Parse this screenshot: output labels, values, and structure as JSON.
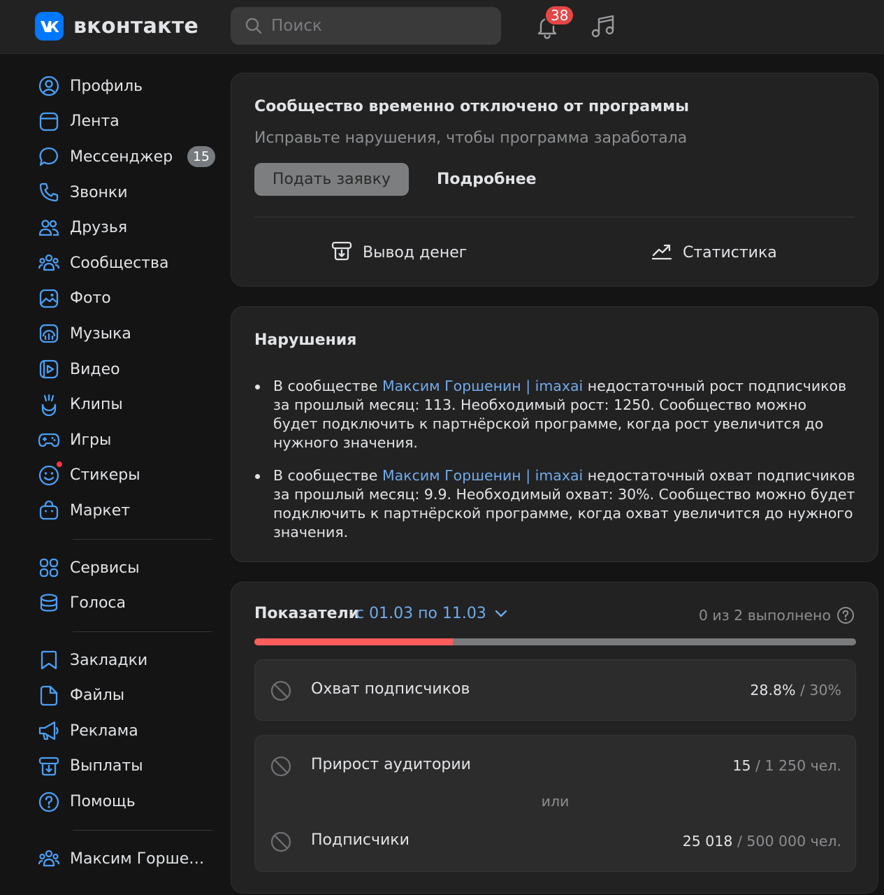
{
  "header": {
    "logo_text": "вконтакте",
    "search_placeholder": "Поиск",
    "notifications_count": "38",
    "brand_color": "#0077ff"
  },
  "sidebar": {
    "items": [
      {
        "label": "Профиль",
        "icon": "user-circle-icon"
      },
      {
        "label": "Лента",
        "icon": "newsfeed-icon"
      },
      {
        "label": "Мессенджер",
        "icon": "message-icon",
        "count": "15"
      },
      {
        "label": "Звонки",
        "icon": "phone-icon"
      },
      {
        "label": "Друзья",
        "icon": "friends-icon"
      },
      {
        "label": "Сообщества",
        "icon": "communities-icon"
      },
      {
        "label": "Фото",
        "icon": "photo-icon"
      },
      {
        "label": "Музыка",
        "icon": "music-icon"
      },
      {
        "label": "Видео",
        "icon": "video-icon"
      },
      {
        "label": "Клипы",
        "icon": "clips-icon"
      },
      {
        "label": "Игры",
        "icon": "gamepad-icon"
      },
      {
        "label": "Стикеры",
        "icon": "smile-icon"
      },
      {
        "label": "Маркет",
        "icon": "market-bag-icon"
      }
    ],
    "group2": [
      {
        "label": "Сервисы",
        "icon": "services-grid-icon"
      },
      {
        "label": "Голоса",
        "icon": "coins-icon"
      }
    ],
    "group3": [
      {
        "label": "Закладки",
        "icon": "bookmark-icon"
      },
      {
        "label": "Файлы",
        "icon": "file-icon"
      },
      {
        "label": "Реклама",
        "icon": "megaphone-icon"
      },
      {
        "label": "Выплаты",
        "icon": "payout-icon"
      },
      {
        "label": "Помощь",
        "icon": "help-icon"
      }
    ],
    "group4": [
      {
        "label": "Максим Горшени...",
        "icon": "community-group-icon"
      }
    ]
  },
  "program_card": {
    "title": "Сообщество временно отключено от программы",
    "subtitle": "Исправьте нарушения, чтобы программа заработала",
    "apply_button": "Подать заявку",
    "more_button": "Подробнее",
    "withdraw_label": "Вывод денег",
    "stats_label": "Статистика"
  },
  "violations_card": {
    "title": "Нарушения",
    "items": [
      {
        "prefix": "В сообществе ",
        "link": "Максим Горшенин | imaxai",
        "text": " недостаточный рост подписчиков за прошлый месяц: 113. Необходимый рост: 1250. Сообщество можно будет подключить к партнёрской программе, когда рост увеличится до нужного значения."
      },
      {
        "prefix": "В сообществе ",
        "link": "Максим Горшенин | imaxai",
        "text": " недостаточный охват подписчиков за прошлый месяц: 9.9. Необходимый охват: 30%. Сообщество можно будет подключить к партнёрской программе, когда охват увеличится до нужного значения."
      }
    ]
  },
  "metrics_card": {
    "title": "Показатели",
    "period": "с 01.03 по 11.03",
    "completed": "0 из 2 выполнено",
    "progress_fraction": 0.33,
    "progress_color": "#ff5c5c",
    "metrics": [
      {
        "label": "Охват подписчиков",
        "current": "28.8%",
        "target": " / 30%"
      },
      {
        "label": "Прирост аудитории",
        "current": "15",
        "target": " / 1 250 чел."
      },
      {
        "label": "Подписчики",
        "current": "25 018",
        "target": " / 500 000 чел."
      }
    ],
    "or_text": "или"
  }
}
